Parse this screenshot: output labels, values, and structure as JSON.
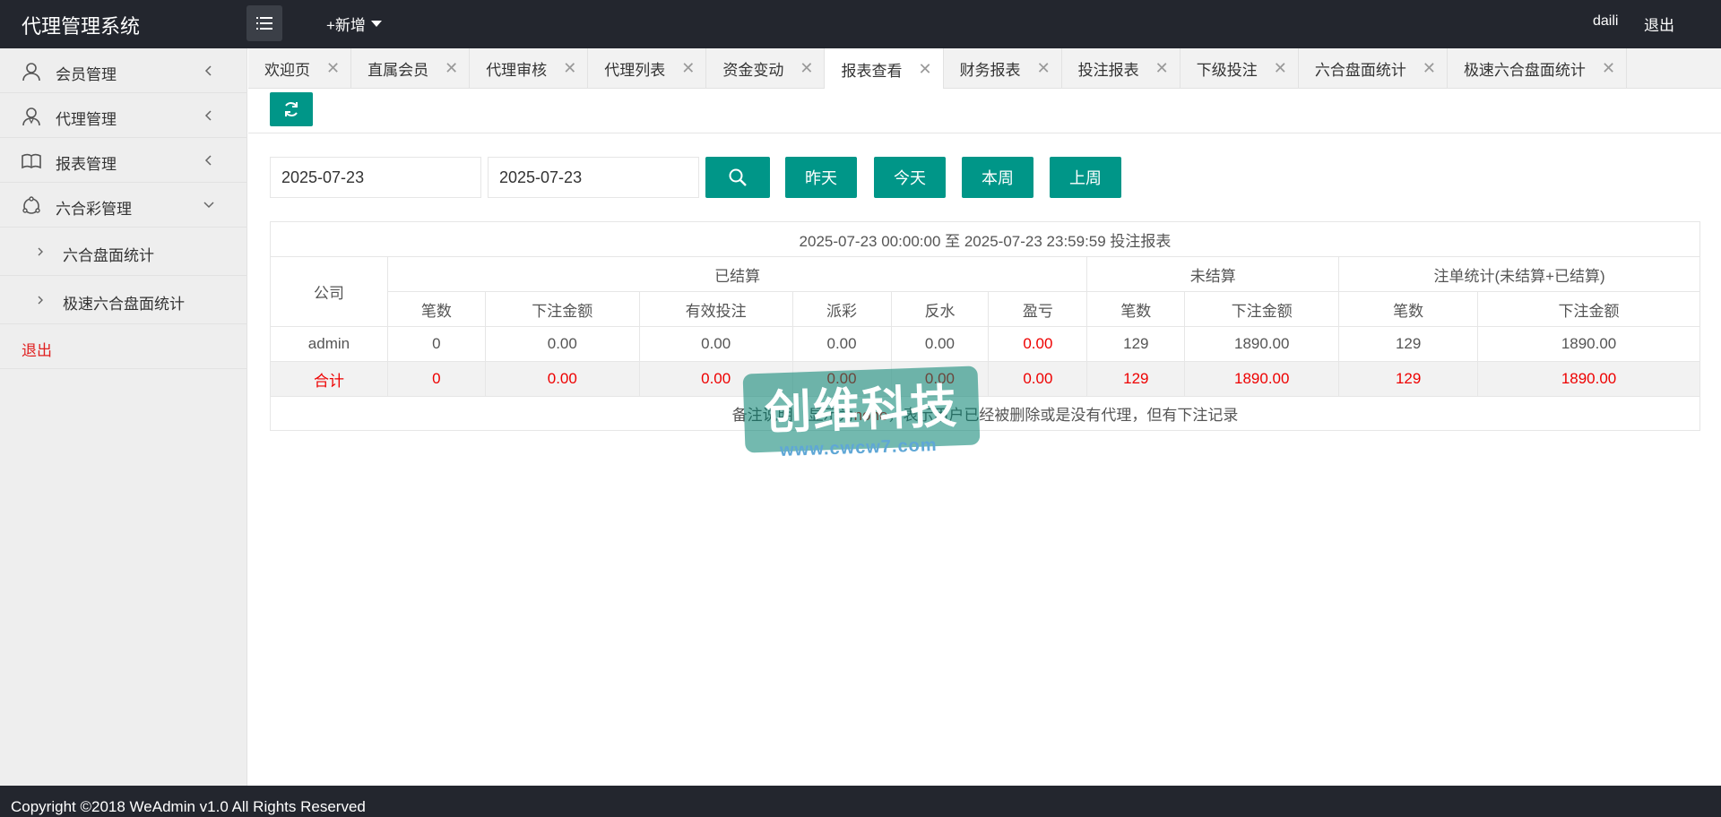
{
  "header": {
    "logo": "代理管理系统",
    "new_label": "+新增",
    "username": "daili",
    "logout": "退出"
  },
  "sidebar": {
    "items": [
      {
        "label": "会员管理",
        "icon": "user-icon"
      },
      {
        "label": "代理管理",
        "icon": "agent-icon"
      },
      {
        "label": "报表管理",
        "icon": "book-icon"
      },
      {
        "label": "六合彩管理",
        "icon": "lottery-icon"
      }
    ],
    "sub_items": [
      "六合盘面统计",
      "极速六合盘面统计"
    ],
    "logout": "退出"
  },
  "tabs": [
    {
      "label": "欢迎页",
      "active": false
    },
    {
      "label": "直属会员",
      "active": false
    },
    {
      "label": "代理审核",
      "active": false
    },
    {
      "label": "代理列表",
      "active": false
    },
    {
      "label": "资金变动",
      "active": false
    },
    {
      "label": "报表查看",
      "active": true
    },
    {
      "label": "财务报表",
      "active": false
    },
    {
      "label": "投注报表",
      "active": false
    },
    {
      "label": "下级投注",
      "active": false
    },
    {
      "label": "六合盘面统计",
      "active": false
    },
    {
      "label": "极速六合盘面统计",
      "active": false
    }
  ],
  "filters": {
    "start_date": "2025-07-23",
    "end_date": "2025-07-23",
    "quick_buttons": [
      "昨天",
      "今天",
      "本周",
      "上周"
    ]
  },
  "report": {
    "caption": "2025-07-23 00:00:00 至 2025-07-23 23:59:59 投注报表",
    "col_company": "公司",
    "group_settled": "已结算",
    "group_unsettled": "未结算",
    "group_total": "注单统计(未结算+已结算)",
    "sub_headers": [
      "笔数",
      "下注金额",
      "有效投注",
      "派彩",
      "反水",
      "盈亏",
      "笔数",
      "下注金额",
      "笔数",
      "下注金额"
    ],
    "rows": [
      {
        "company": "admin",
        "cells": [
          "0",
          "0.00",
          "0.00",
          "0.00",
          "0.00",
          "0.00",
          "129",
          "1890.00",
          "129",
          "1890.00"
        ]
      }
    ],
    "total": {
      "company": "合计",
      "cells": [
        "0",
        "0.00",
        "0.00",
        "0.00",
        "0.00",
        "0.00",
        "129",
        "1890.00",
        "129",
        "1890.00"
      ]
    },
    "note_prefix": "备注说明：显示为",
    "note_none": "none",
    "note_suffix": "，表示用户已经被删除或是没有代理，但有下注记录"
  },
  "watermark": {
    "title": "创维科技",
    "url": "www.cwcw7.com"
  },
  "footer": {
    "copyright": "Copyright ©2018 WeAdmin v1.0 All Rights Reserved"
  },
  "colors": {
    "accent": "#009688",
    "header_bg": "#23262e",
    "danger": "#e00000"
  }
}
